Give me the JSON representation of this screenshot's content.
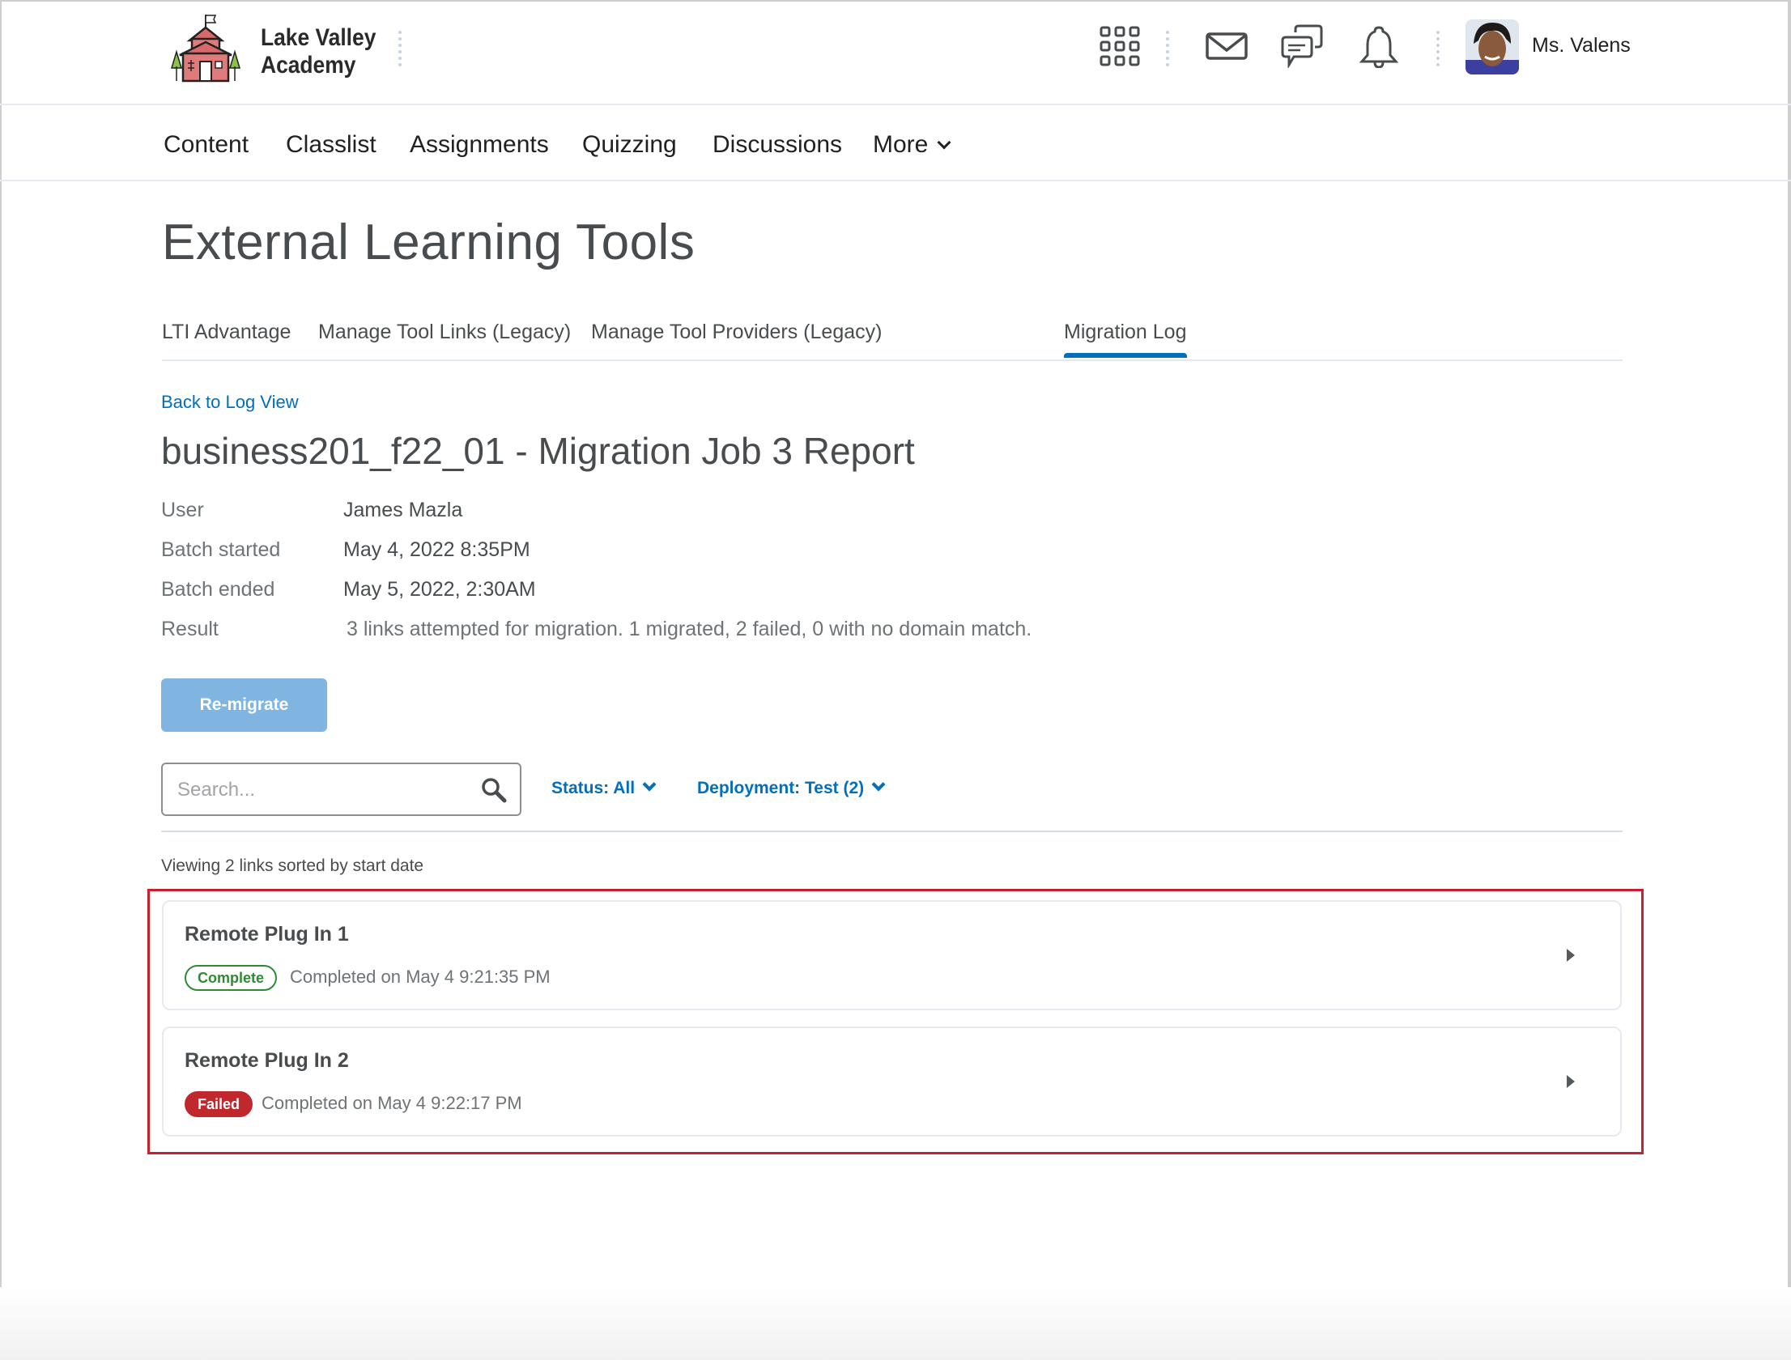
{
  "header": {
    "brand_line1": "Lake Valley",
    "brand_line2": "Academy",
    "icons": [
      "apps-grid-icon",
      "mail-icon",
      "chat-icon",
      "bell-icon"
    ],
    "user_name": "Ms. Valens"
  },
  "nav": {
    "items": [
      "Content",
      "Classlist",
      "Assignments",
      "Quizzing",
      "Discussions",
      "More"
    ]
  },
  "page": {
    "title": "External Learning Tools",
    "tabs": [
      "LTI Advantage",
      "Manage Tool Links (Legacy)",
      "Manage Tool Providers (Legacy)",
      "Migration Log"
    ],
    "active_tab": "Migration Log",
    "back_link": "Back to Log View",
    "report_title": "business201_f22_01 - Migration Job 3 Report"
  },
  "meta": {
    "user_label": "User",
    "user_value": "James Mazla",
    "started_label": "Batch started",
    "started_value": "May 4, 2022 8:35PM",
    "ended_label": "Batch ended",
    "ended_value": "May 5, 2022, 2:30AM",
    "result_label": "Result",
    "result_value": "3 links attempted for migration. 1 migrated, 2 failed, 0 with no domain match."
  },
  "actions": {
    "remigrate_label": "Re-migrate",
    "search_placeholder": "Search...",
    "status_filter": "Status: All",
    "deployment_filter": "Deployment: Test (2)"
  },
  "list": {
    "summary": "Viewing 2 links sorted by start date",
    "items": [
      {
        "title": "Remote Plug In 1",
        "status": "Complete",
        "date": "Completed on May 4 9:21:35 PM"
      },
      {
        "title": "Remote Plug In 2",
        "status": "Failed",
        "date": "Completed on May 4 9:22:17 PM"
      }
    ]
  },
  "colors": {
    "accent": "#006fbf",
    "complete": "#2e8b33",
    "failed": "#c0282e",
    "highlight": "#c8202f"
  }
}
